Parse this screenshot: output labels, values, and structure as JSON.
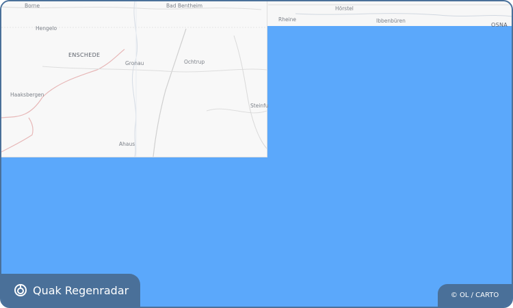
{
  "brand": {
    "title": "Quak Regenradar",
    "icon": "radar-target-icon"
  },
  "attribution": {
    "text": "© OL / CARTO"
  },
  "colors": {
    "frame": "#4a7099",
    "radar_overlay": "#5ba8fb",
    "map_background": "#f8f8f8"
  },
  "map": {
    "places": {
      "borne": "Borne",
      "bad_bentheim": "Bad Bentheim",
      "horstel": "Hörstel",
      "rheine": "Rheine",
      "ibbenburen": "Ibbenbüren",
      "osnabruck": "OSNA",
      "hengelo": "Hengelo",
      "enschede": "ENSCHEDE",
      "gronau": "Gronau",
      "ochtrup": "Ochtrup",
      "haaksbergen": "Haaksbergen",
      "steinfurt": "Steinfu",
      "ahaus": "Ahaus"
    }
  }
}
